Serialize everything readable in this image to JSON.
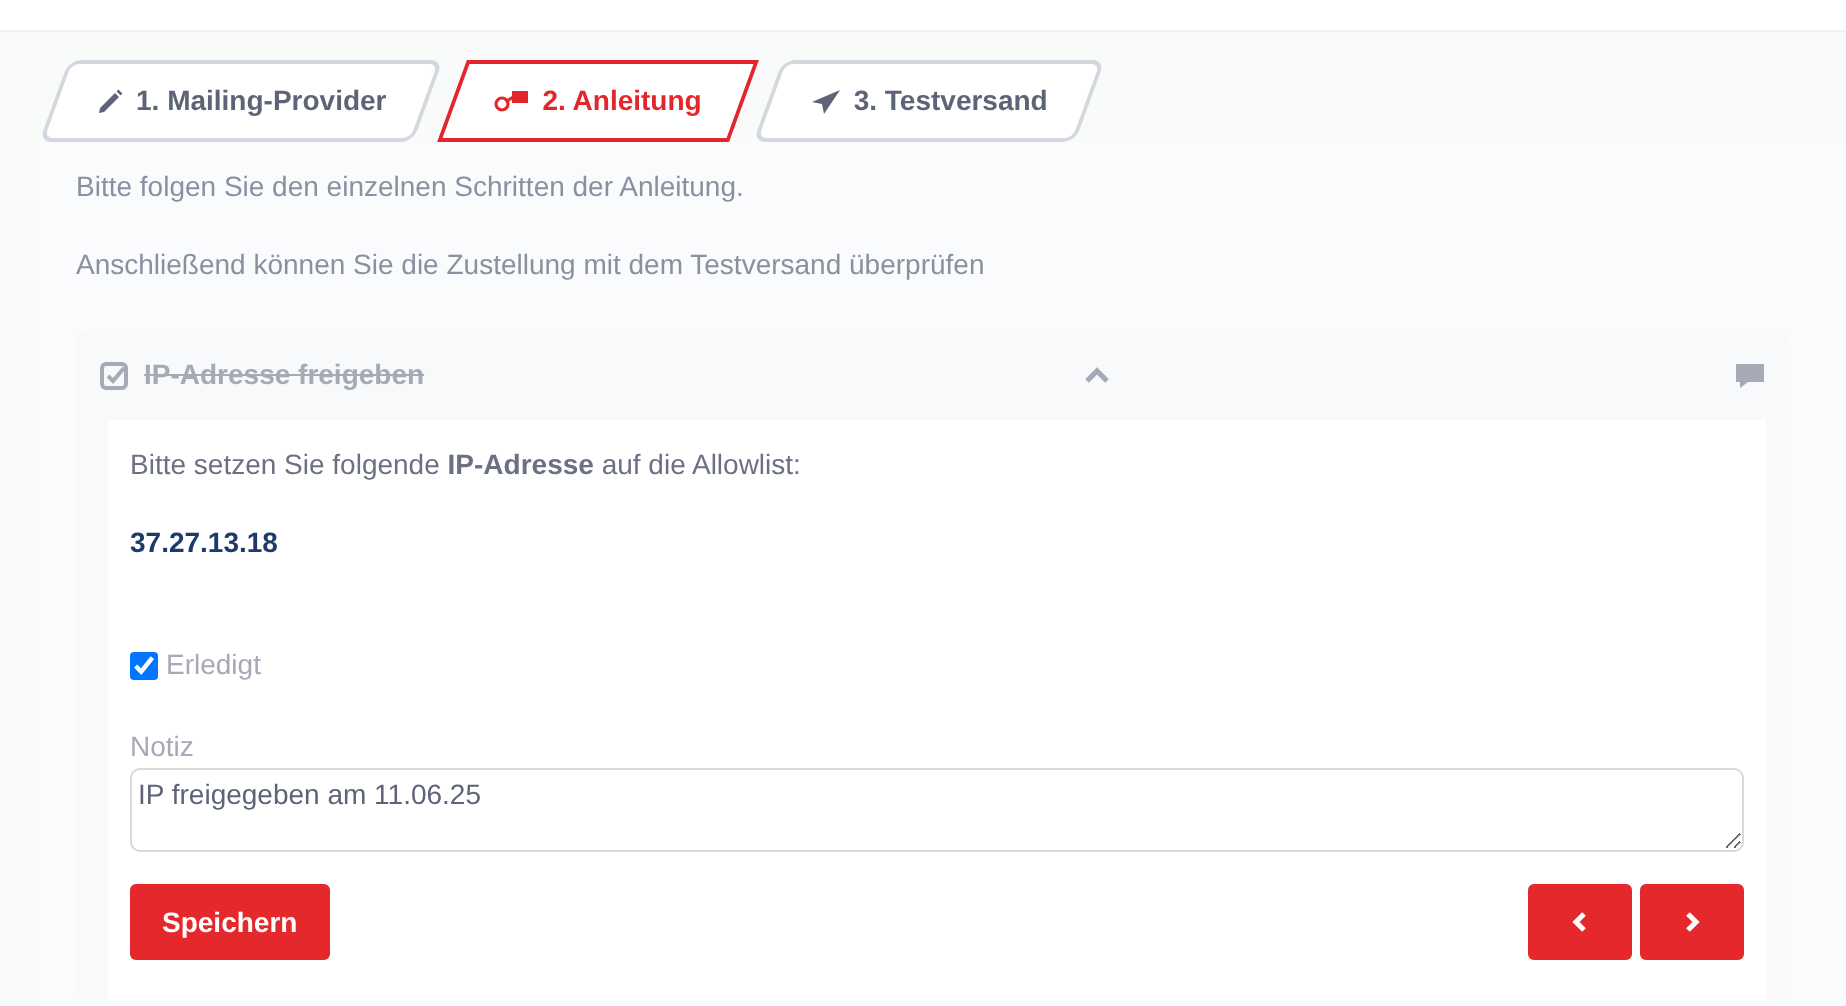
{
  "tabs": [
    {
      "label": "1. Mailing-Provider",
      "selected": false
    },
    {
      "label": "2. Anleitung",
      "selected": true
    },
    {
      "label": "3. Testversand",
      "selected": false
    }
  ],
  "intro": [
    "Bitte folgen Sie den einzelnen Schritten der Anleitung.",
    "Anschließend können Sie die Zustellung mit dem Testversand überprüfen"
  ],
  "step": {
    "title": "IP-Adresse freigeben",
    "done": true,
    "expanded": true,
    "instruction": "Bitte setzen Sie folgende **IP-Adresse** auf die Allowlist:",
    "ip": "37.27.13.18",
    "checkbox": {
      "label": "Erledigt",
      "checked": true
    },
    "note": {
      "label": "Notiz",
      "value": "IP freigegeben am 11.06.25"
    },
    "save_button": "Speichern"
  }
}
